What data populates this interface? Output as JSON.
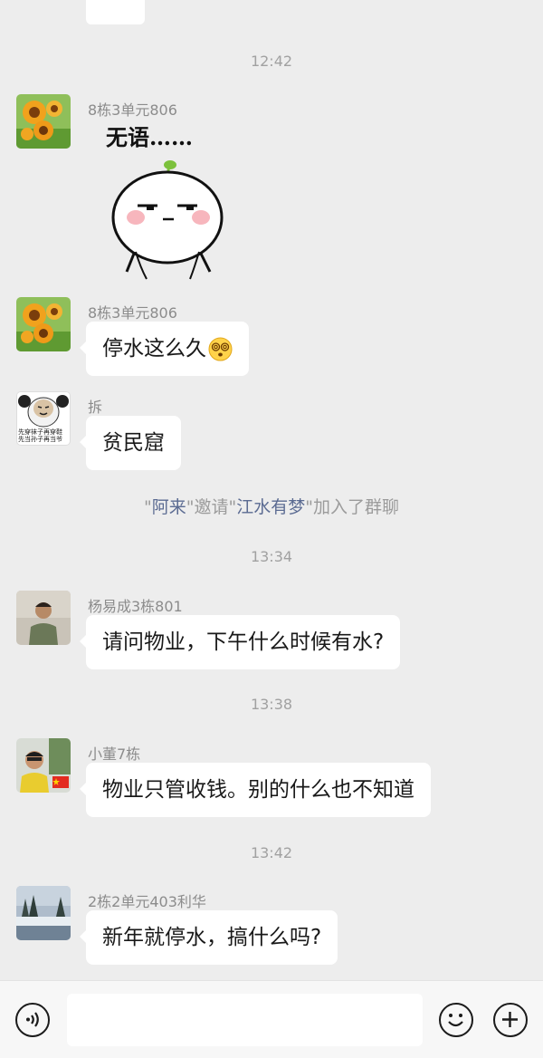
{
  "messages": [
    {
      "type": "time",
      "text": "12:42"
    },
    {
      "sender": "8栋3单元806",
      "sticker_text": "无语……",
      "sticker": "speechless-bun-sticker"
    },
    {
      "sender": "8栋3单元806",
      "text": "停水这么久",
      "emoji": "dizzy-face-emoji"
    },
    {
      "sender": "拆",
      "text": "贫民窟",
      "avatar_caption_1": "先穿袜子再穿鞋",
      "avatar_caption_2": "先当孙子再当爷"
    },
    {
      "type": "system",
      "inviter": "阿来",
      "invite_word": "邀请",
      "invitee": "江水有梦",
      "joined": "加入了群聊",
      "quote_open": "\"",
      "quote_close": "\""
    },
    {
      "type": "time",
      "text": "13:34"
    },
    {
      "sender": "杨易成3栋801",
      "text": "请问物业，下午什么时候有水?"
    },
    {
      "type": "time",
      "text": "13:38"
    },
    {
      "sender": "小董7栋",
      "text": "物业只管收钱。别的什么也不知道"
    },
    {
      "type": "time",
      "text": "13:42"
    },
    {
      "sender": "2栋2单元403利华",
      "text": "新年就停水，搞什么吗?"
    }
  ],
  "input_bar": {
    "voice_icon": "voice-icon",
    "emoji_icon": "smiley-icon",
    "plus_icon": "plus-icon"
  }
}
